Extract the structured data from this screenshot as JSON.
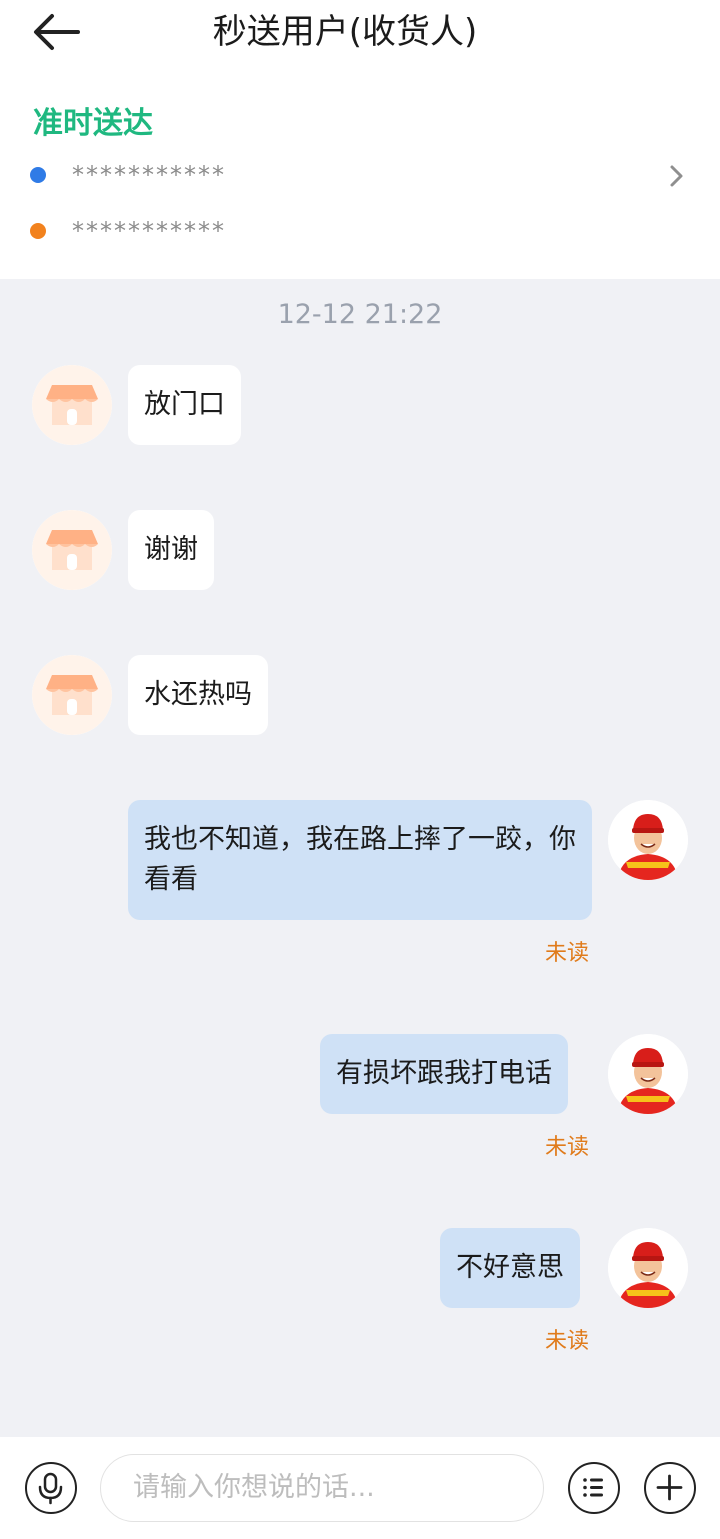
{
  "header": {
    "title": "秒送用户(收货人)"
  },
  "order": {
    "status": "准时送达",
    "from_address": "***********",
    "to_address": "***********"
  },
  "chat": {
    "timestamp": "12-12 21:22",
    "messages": [
      {
        "side": "in",
        "text": "放门口"
      },
      {
        "side": "in",
        "text": "谢谢"
      },
      {
        "side": "in",
        "text": "水还热吗"
      },
      {
        "side": "out",
        "text": "我也不知道，我在路上摔了一跤，你看看",
        "status": "未读"
      },
      {
        "side": "out",
        "text": "有损坏跟我打电话",
        "status": "未读"
      },
      {
        "side": "out",
        "text": "不好意思",
        "status": "未读"
      }
    ]
  },
  "composer": {
    "placeholder": "请输入你想说的话..."
  },
  "icons": {
    "back": "arrow-left-icon",
    "chevron": "chevron-right-icon",
    "mic": "microphone-icon",
    "menu": "list-icon",
    "add": "plus-icon"
  },
  "colors": {
    "status_green": "#1fb880",
    "unread_orange": "#e07b1b",
    "out_bubble": "#cfe1f6",
    "chat_bg": "#f0f1f5"
  }
}
